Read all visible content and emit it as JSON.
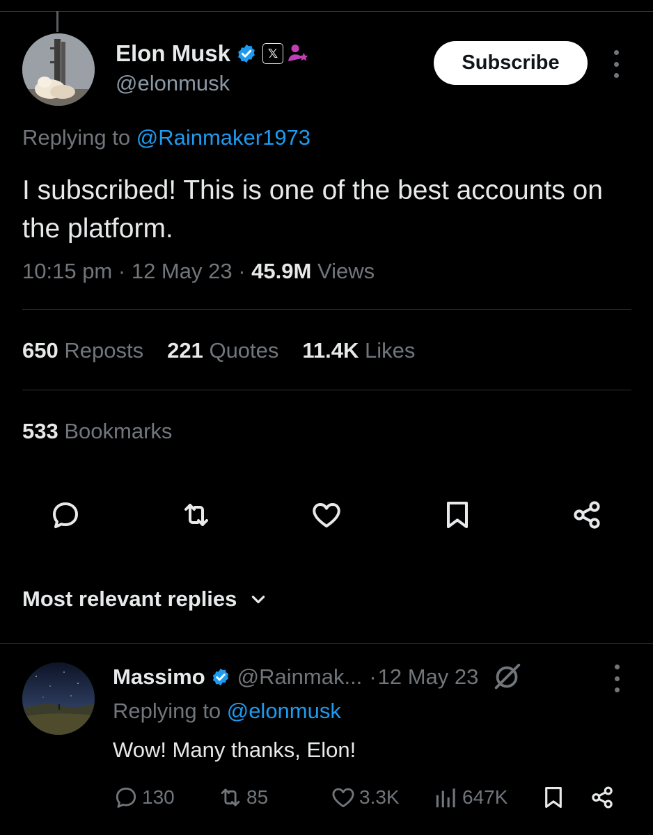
{
  "colors": {
    "background": "#000000",
    "accent": "#1d9bf0",
    "muted": "#71767b",
    "text": "#e7e9ea",
    "divider": "#2f3336",
    "verified": "#1d9bf0",
    "subscriber_icon": "#c13fb6"
  },
  "tweet": {
    "author_name": "Elon Musk",
    "author_handle": "@elonmusk",
    "affiliation_badge": "𝕏",
    "subscribe_label": "Subscribe",
    "replying_prefix": "Replying to ",
    "replying_to": "@Rainmaker1973",
    "text": "I subscribed! This is one of the best accounts on the platform.",
    "time": "10:15 pm",
    "date": "12 May 23",
    "views_count": "45.9M",
    "views_label": "Views",
    "stats": {
      "reposts_count": "650",
      "reposts_label": "Reposts",
      "quotes_count": "221",
      "quotes_label": "Quotes",
      "likes_count": "11.4K",
      "likes_label": "Likes",
      "bookmarks_count": "533",
      "bookmarks_label": "Bookmarks"
    },
    "actions": [
      "reply-icon",
      "repost-icon",
      "like-icon",
      "bookmark-icon",
      "share-icon"
    ]
  },
  "replies_sort": {
    "label": "Most relevant replies"
  },
  "reply": {
    "author_name": "Massimo",
    "author_handle": "@Rainmak...",
    "date": "12 May 23",
    "replying_prefix": "Replying to ",
    "replying_to": "@elonmusk",
    "text": "Wow! Many thanks, Elon!",
    "replies_count": "130",
    "reposts_count": "85",
    "likes_count": "3.3K",
    "views_count": "647K"
  }
}
